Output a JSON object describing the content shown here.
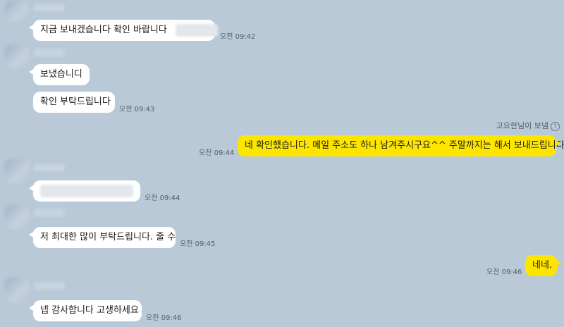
{
  "messages": [
    {
      "side": "in",
      "text": "지금 보내겠습니다 확인 바랍니다",
      "time": "오전 09:42"
    },
    {
      "side": "in",
      "text": "보냈습니디",
      "time": ""
    },
    {
      "side": "in",
      "text": "확인 부탁드립니다",
      "time": "오전 09:43"
    },
    {
      "side": "out",
      "text": "네 확인했습니다. 메일 주소도 하나 남겨주시구요^^ 주말까지는 해서 보내드립니다",
      "time": "오전 09:44"
    },
    {
      "side": "in",
      "text": "",
      "time": "오전 09:44"
    },
    {
      "side": "in",
      "text": "저 최대한 많이 부탁드립니다. 줄 수",
      "time": "오전 09:45"
    },
    {
      "side": "out",
      "text": "네네.",
      "time": "오전 09:46"
    },
    {
      "side": "in",
      "text": "넵 감사합니다 고생하세요",
      "time": "오전 09:46"
    }
  ],
  "notice": {
    "text": "고요한님이 보냄",
    "icon": "help-icon"
  },
  "colors": {
    "background": "#b9c9d8",
    "incoming": "#ffffff",
    "outgoing": "#fee500"
  }
}
